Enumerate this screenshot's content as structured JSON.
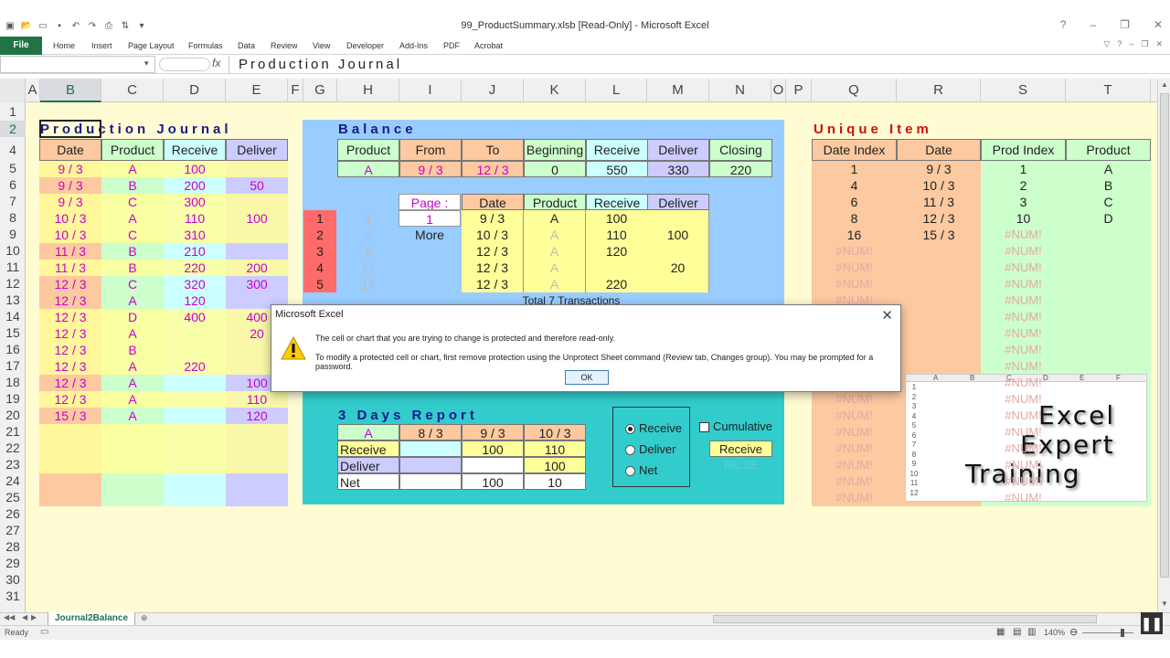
{
  "window": {
    "title": "99_ProductSummary.xlsb  [Read-Only]  -  Microsoft Excel",
    "controls": [
      "?",
      "–",
      "❐",
      "✕"
    ]
  },
  "ribbon": {
    "file": "File",
    "tabs": [
      "Home",
      "Insert",
      "Page Layout",
      "Formulas",
      "Data",
      "Review",
      "View",
      "Developer",
      "Add-Ins",
      "PDF",
      "Acrobat"
    ]
  },
  "formula_bar": {
    "name_box": "",
    "fx": "fx",
    "formula": "Production Journal"
  },
  "columns": [
    "A",
    "B",
    "C",
    "D",
    "E",
    "F",
    "G",
    "H",
    "I",
    "J",
    "K",
    "L",
    "M",
    "N",
    "O",
    "P",
    "Q",
    "R",
    "S",
    "T"
  ],
  "rows": [
    "1",
    "2",
    "4",
    "5",
    "6",
    "7",
    "8",
    "9",
    "10",
    "11",
    "12",
    "13",
    "14",
    "15",
    "16",
    "17",
    "18",
    "19",
    "20",
    "21",
    "22",
    "23",
    "24",
    "25",
    "26",
    "27",
    "28",
    "29",
    "30",
    "31"
  ],
  "journal": {
    "title": "Production Journal",
    "headers": [
      "Date",
      "Product",
      "Receive",
      "Deliver"
    ],
    "rows": [
      [
        "9 / 3",
        "A",
        "100",
        ""
      ],
      [
        "9 / 3",
        "B",
        "200",
        "50"
      ],
      [
        "9 / 3",
        "C",
        "300",
        ""
      ],
      [
        "10 / 3",
        "A",
        "110",
        "100"
      ],
      [
        "10 / 3",
        "C",
        "310",
        ""
      ],
      [
        "11 / 3",
        "B",
        "210",
        ""
      ],
      [
        "11 / 3",
        "B",
        "220",
        "200"
      ],
      [
        "12 / 3",
        "C",
        "320",
        "300"
      ],
      [
        "12 / 3",
        "A",
        "120",
        ""
      ],
      [
        "12 / 3",
        "D",
        "400",
        "400"
      ],
      [
        "12 / 3",
        "A",
        "",
        "20"
      ],
      [
        "12 / 3",
        "B",
        "",
        ""
      ],
      [
        "12 / 3",
        "A",
        "220",
        ""
      ],
      [
        "12 / 3",
        "A",
        "",
        "100"
      ],
      [
        "12 / 3",
        "A",
        "",
        "110"
      ],
      [
        "15 / 3",
        "A",
        "",
        "120"
      ]
    ]
  },
  "balance": {
    "title": "Balance",
    "headers": [
      "Product",
      "From",
      "To",
      "Beginning",
      "Receive",
      "Deliver",
      "Closing"
    ],
    "values": [
      "A",
      "9 / 3",
      "12 / 3",
      "0",
      "550",
      "330",
      "220"
    ]
  },
  "transactions": {
    "page_label": "Page :",
    "page_value": "1",
    "more_label": "More",
    "headers": [
      "Date",
      "Product",
      "Receive",
      "Deliver"
    ],
    "index_red": [
      "1",
      "2",
      "3",
      "4",
      "5"
    ],
    "index_grey": [
      "1",
      "4",
      "9",
      "11",
      "13"
    ],
    "rows": [
      [
        "9 / 3",
        "A",
        "100",
        ""
      ],
      [
        "10 / 3",
        "A",
        "110",
        "100"
      ],
      [
        "12 / 3",
        "A",
        "120",
        ""
      ],
      [
        "12 / 3",
        "A",
        "",
        "20"
      ],
      [
        "12 / 3",
        "A",
        "220",
        ""
      ]
    ],
    "total": "Total 7 Transactions"
  },
  "report": {
    "title": "3 Days Report",
    "headers": [
      "A",
      "8 / 3",
      "9 / 3",
      "10 / 3"
    ],
    "rows": [
      [
        "Receive",
        "",
        "100",
        "110"
      ],
      [
        "Deliver",
        "",
        "",
        "100"
      ],
      [
        "Net",
        "",
        "100",
        "10"
      ]
    ],
    "options": [
      "Receive",
      "Deliver",
      "Net"
    ],
    "selected_option": "Receive",
    "cumulative_label": "Cumulative",
    "cumulative_checked": false,
    "current_value": "Receive",
    "flag": "FALSE"
  },
  "unique": {
    "title": "Unique Item",
    "headers": [
      "Date Index",
      "Date",
      "Prod Index",
      "Product"
    ],
    "date_index": [
      "1",
      "4",
      "6",
      "8",
      "16",
      "#NUM!",
      "#NUM!",
      "#NUM!",
      "#NUM!",
      "#NUM!",
      "#NUM!",
      "#NUM!",
      "#NUM!",
      "#NUM!",
      "#NUM!",
      "#NUM!",
      "#NUM!",
      "#NUM!",
      "#NUM!",
      "#NUM!",
      "#NUM!"
    ],
    "dates": [
      "9 / 3",
      "10 / 3",
      "11 / 3",
      "12 / 3",
      "15 / 3"
    ],
    "prod_index": [
      "1",
      "2",
      "3",
      "10",
      "#NUM!",
      "#NUM!",
      "#NUM!",
      "#NUM!",
      "#NUM!",
      "#NUM!",
      "#NUM!",
      "#NUM!",
      "#NUM!",
      "#NUM!",
      "#NUM!",
      "#NUM!",
      "#NUM!",
      "#NUM!",
      "#NUM!",
      "#NUM!",
      "#NUM!"
    ],
    "products": [
      "A",
      "B",
      "C",
      "D"
    ]
  },
  "logo": {
    "line1": "Excel",
    "line2": "Expert",
    "line3": "Training",
    "mini_cols": [
      "A",
      "B",
      "C",
      "D",
      "E",
      "F"
    ],
    "mini_rows": [
      "1",
      "2",
      "3",
      "4",
      "5",
      "6",
      "7",
      "8",
      "9",
      "10",
      "11",
      "12"
    ]
  },
  "dialog": {
    "title": "Microsoft Excel",
    "message1": "The cell or chart that you are trying to change is protected and therefore read-only.",
    "message2": "To modify a protected cell or chart, first remove protection using the Unprotect Sheet command (Review tab, Changes group). You may be prompted for a password.",
    "ok": "OK"
  },
  "sheet_tab": "Journal2Balance",
  "status": {
    "ready": "Ready",
    "zoom": "140%"
  },
  "colors": {
    "excel_green": "#217346",
    "sheet_bg": "#fffbd2",
    "balance_panel": "#99ccff",
    "report_panel": "#33cccc",
    "orange": "#fcc9a0",
    "yellow": "#ffff99",
    "green": "#ccffcc",
    "cyan": "#ccffff",
    "lavender": "#ccccff",
    "red_index": "#ff6b6b"
  }
}
